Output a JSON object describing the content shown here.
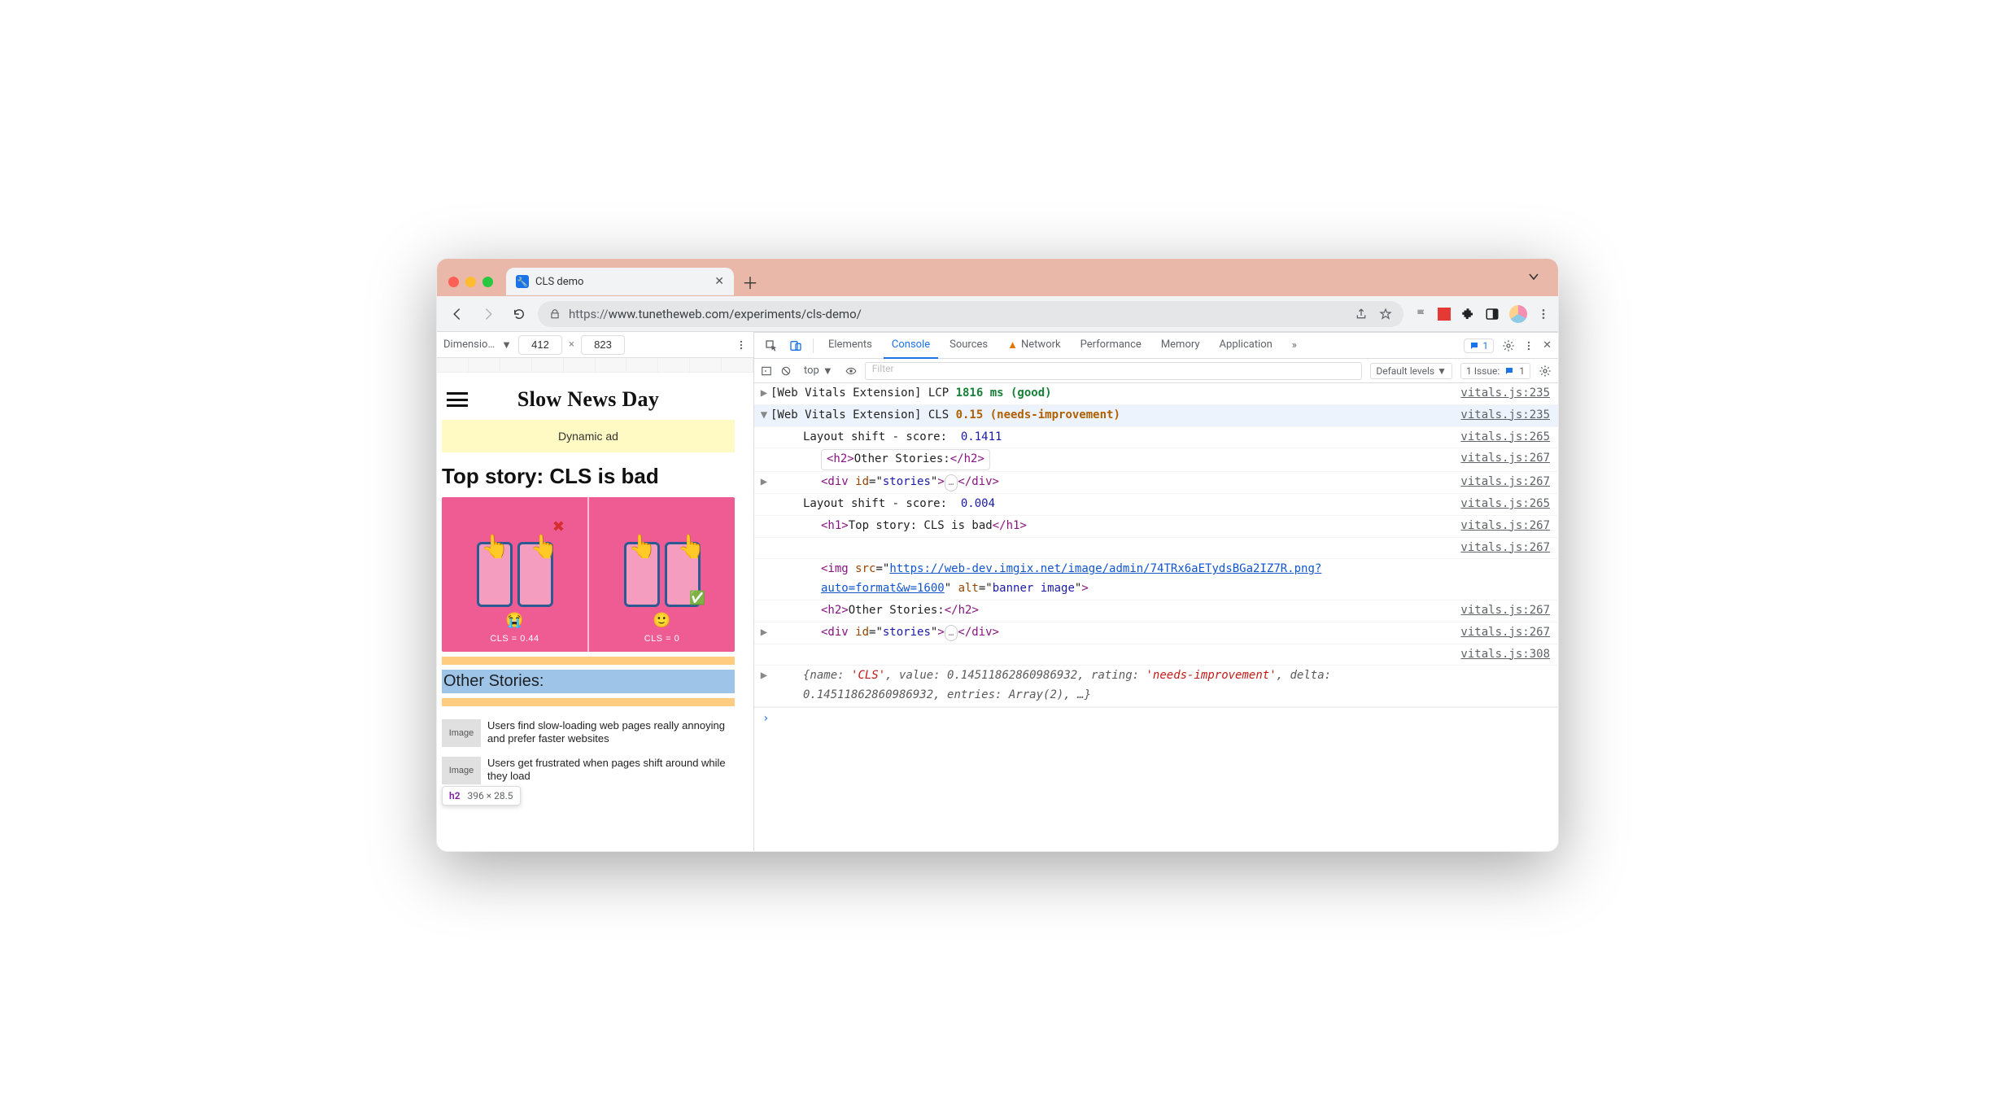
{
  "window": {
    "tab_title": "CLS demo",
    "url_proto": "https://",
    "url_rest": "www.tunetheweb.com/experiments/cls-demo/"
  },
  "device_toolbar": {
    "label": "Dimensio…",
    "width": "412",
    "height": "823",
    "times": "×"
  },
  "hover_tip": {
    "tag": "h2",
    "dims": "396 × 28.5"
  },
  "site": {
    "title": "Slow News Day",
    "ad": "Dynamic ad",
    "top_story": "Top story: CLS is bad",
    "cls_left_label": "CLS = 0.44",
    "cls_right_label": "CLS = 0",
    "cls_left_emoji": "😭",
    "cls_right_emoji": "🙂",
    "other_heading": "Other Stories:",
    "image_ph": "Image",
    "stories": [
      "Users find slow-loading web pages really annoying and prefer faster websites",
      "Users get frustrated when pages shift around while they load"
    ]
  },
  "devtools": {
    "panels": [
      "Elements",
      "Console",
      "Sources",
      "Network",
      "Performance",
      "Memory",
      "Application"
    ],
    "active_panel": "Console",
    "pill_count": "1",
    "filter_top": "top",
    "filter_placeholder": "Filter",
    "levels": "Default levels",
    "issue_label": "1 Issue:",
    "issue_count": "1"
  },
  "console": {
    "rows": [
      {
        "type": "group-collapsed",
        "arrow": "▶",
        "html": "<span>[Web Vitals Extension] LCP </span><span class='good'>1816 ms (good)</span>",
        "loc": "vitals.js:235"
      },
      {
        "type": "group-open",
        "arrow": "▼",
        "hover": true,
        "html": "<span>[Web Vitals Extension] CLS </span><span class='warn'>0.15 (needs-improvement)</span>",
        "loc": "vitals.js:235"
      },
      {
        "type": "line",
        "indent": 1,
        "html": "Layout shift - score:&nbsp;&nbsp;<span class='num'>0.1411</span>",
        "loc": "vitals.js:265"
      },
      {
        "type": "line",
        "indent": 2,
        "html": "<span class='pillcode'><span class='htag'>&lt;h2&gt;</span>Other Stories:<span class='htag'>&lt;/h2&gt;</span></span>",
        "loc": "vitals.js:267"
      },
      {
        "type": "line",
        "indent": 2,
        "arrow": "▶",
        "html": "<span class='htag'>&lt;div</span> <span class='hattr'>id</span>=&quot;<span class='hstr'>stories</span>&quot;<span class='htag'>&gt;</span><span class='ell'>…</span><span class='htag'>&lt;/div&gt;</span>",
        "loc": "vitals.js:267"
      },
      {
        "type": "line",
        "indent": 1,
        "html": "Layout shift - score:&nbsp;&nbsp;<span class='num'>0.004</span>",
        "loc": "vitals.js:265"
      },
      {
        "type": "line",
        "indent": 2,
        "html": "<span class='htag'>&lt;h1&gt;</span>Top story: CLS is bad<span class='htag'>&lt;/h1&gt;</span>",
        "loc": "vitals.js:267"
      },
      {
        "type": "line",
        "indent": 2,
        "loc_only": true,
        "html": "",
        "loc": "vitals.js:267"
      },
      {
        "type": "line",
        "indent": 2,
        "html": "<span class='htag'>&lt;img</span> <span class='hattr'>src</span>=&quot;<span class='hlink'>https://web-dev.imgix.net/image/admin/74TRx6aETydsBGa2IZ7R.png?auto=format&amp;w=1600</span>&quot; <span class='hattr'>alt</span>=&quot;<span class='hstr'>banner image</span>&quot;<span class='htag'>&gt;</span>",
        "loc": ""
      },
      {
        "type": "line",
        "indent": 2,
        "html": "<span class='htag'>&lt;h2&gt;</span>Other Stories:<span class='htag'>&lt;/h2&gt;</span>",
        "loc": "vitals.js:267"
      },
      {
        "type": "line",
        "indent": 2,
        "arrow": "▶",
        "html": "<span class='htag'>&lt;div</span> <span class='hattr'>id</span>=&quot;<span class='hstr'>stories</span>&quot;<span class='htag'>&gt;</span><span class='ell'>…</span><span class='htag'>&lt;/div&gt;</span>",
        "loc": "vitals.js:267"
      },
      {
        "type": "line",
        "indent": 2,
        "loc_only": true,
        "html": "",
        "loc": "vitals.js:308"
      },
      {
        "type": "line",
        "indent": 1,
        "arrow": "▶",
        "html": "<span class='italic'>{name: <span class='strv'>'CLS'</span>, value: <span>0.14511862860986932</span>, rating: <span class='strv'>'needs-improvement'</span>, delta: <span>0.14511862860986932</span>, entries: Array(2), …}</span>",
        "loc": ""
      }
    ],
    "prompt": "›"
  }
}
